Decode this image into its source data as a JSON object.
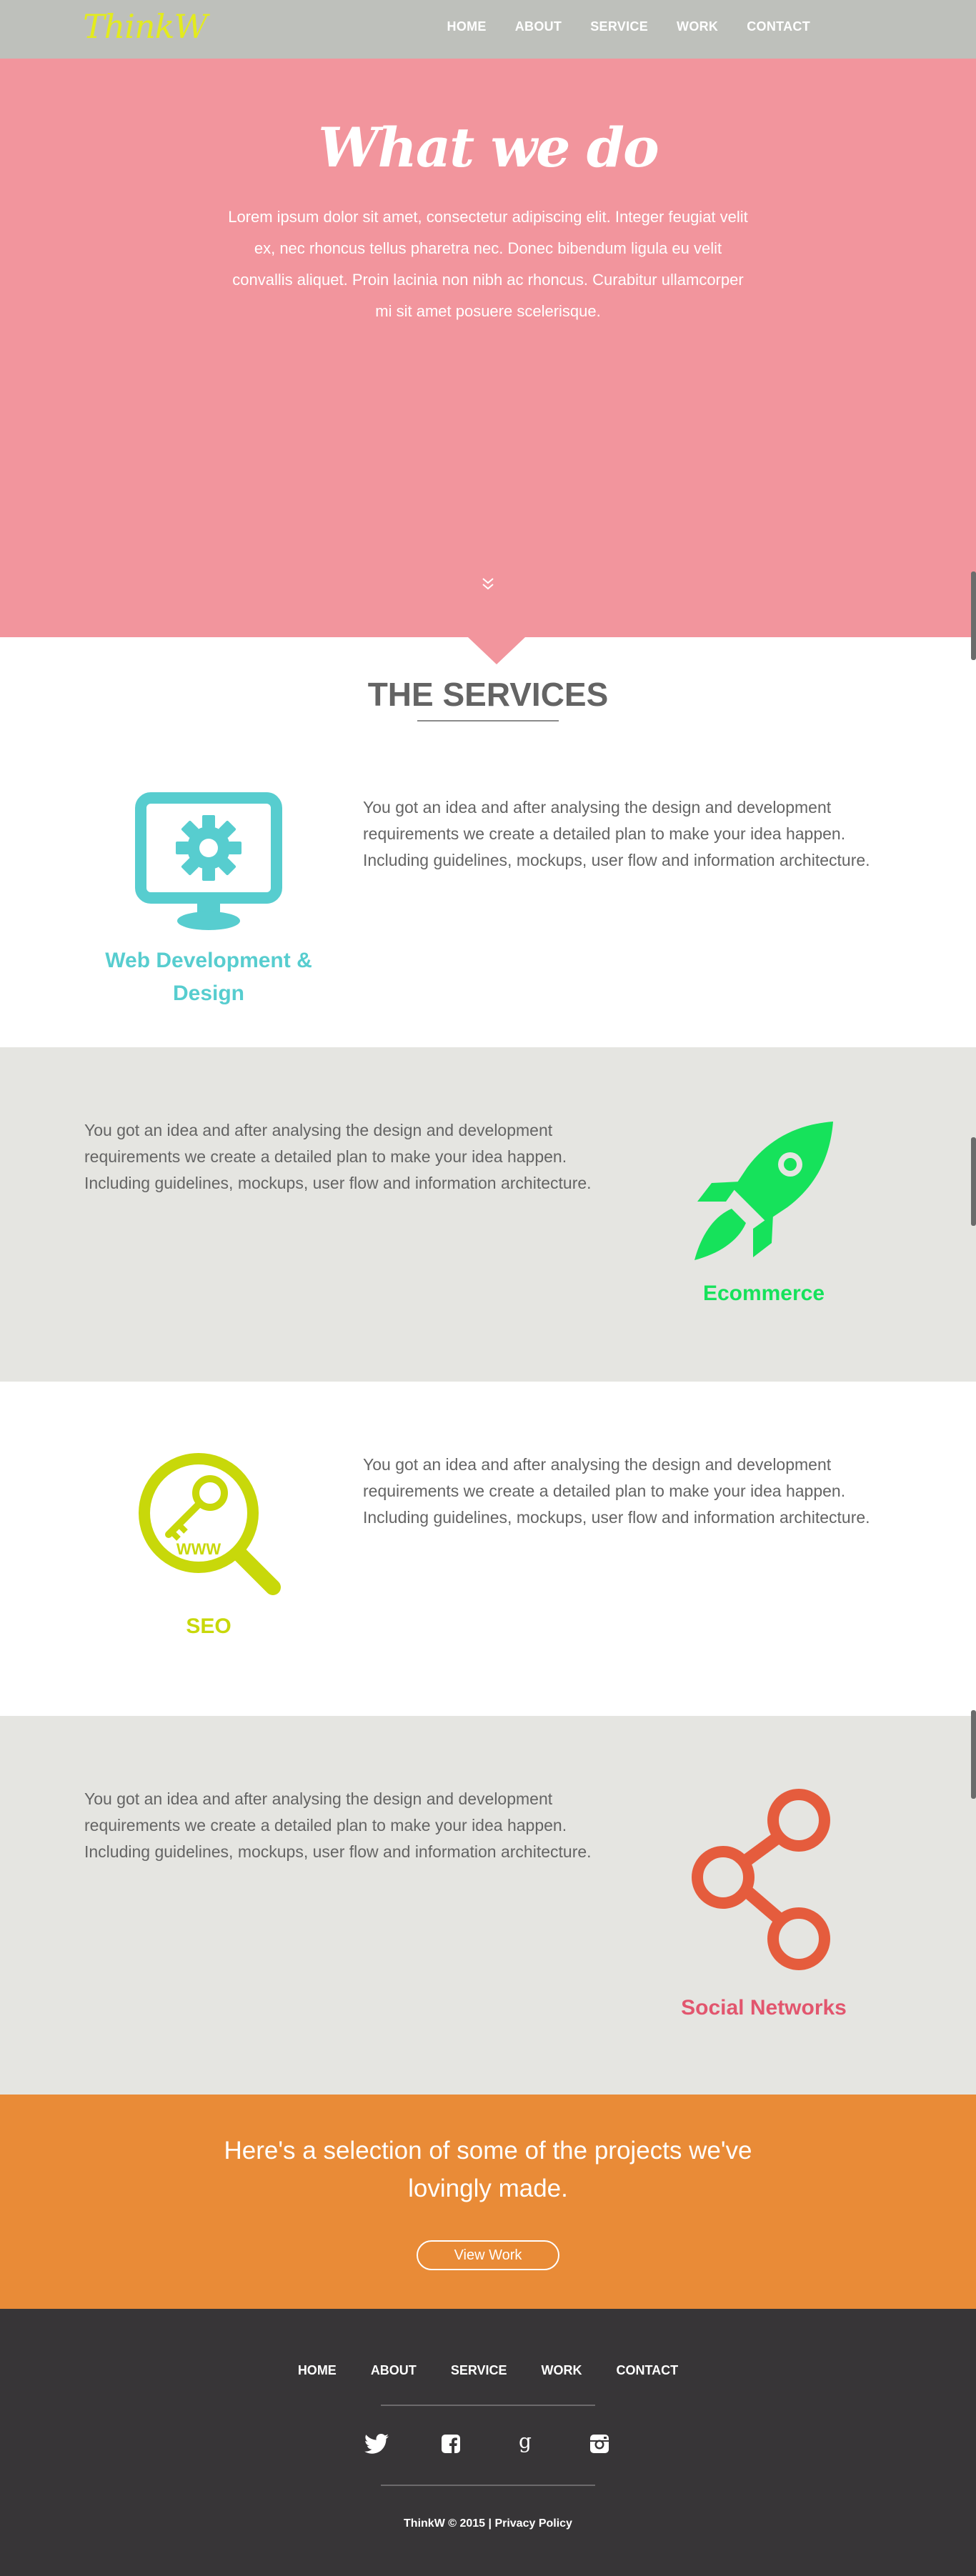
{
  "nav": {
    "logo": "ThinkW",
    "links": [
      "HOME",
      "ABOUT",
      "SERVICE",
      "WORK",
      "CONTACT"
    ]
  },
  "hero": {
    "title": "What we do",
    "text": "Lorem ipsum dolor sit amet, consectetur adipiscing elit. Integer feugiat velit ex, nec rhoncus tellus pharetra nec. Donec bibendum ligula eu velit convallis aliquet. Proin lacinia non nibh ac rhoncus. Curabitur ullamcorper mi sit amet posuere scelerisque.",
    "scroll_icon": "double-chevron-down-icon"
  },
  "services": {
    "title": "THE SERVICES",
    "items": [
      {
        "name": "Web Development & Design",
        "text": "You got an idea and after analysing the design and development requirements we create a detailed plan to make your idea happen. Including guidelines, mockups, user flow and information architecture.",
        "icon": "monitor-gear-icon",
        "color": "#57cdcf"
      },
      {
        "name": "Ecommerce",
        "text": "You got an idea and after analysing the design and development requirements we create a detailed plan to make your idea happen. Including guidelines, mockups, user flow and information architecture.",
        "icon": "rocket-icon",
        "color": "#16e25b"
      },
      {
        "name": "SEO",
        "text": "You got an idea and after analysing the design and development requirements we create a detailed plan to make your idea happen. Including guidelines, mockups, user flow and information architecture.",
        "icon": "magnifier-key-icon",
        "color": "#c8d80a"
      },
      {
        "name": "Social Networks",
        "text": "You got an idea and after analysing the design and development requirements we create a detailed plan to make your idea happen. Including guidelines, mockups, user flow and information architecture.",
        "icon": "share-icon",
        "color": "#e55c3d",
        "label_color": "#e2566e"
      }
    ]
  },
  "projects": {
    "title": "Here's a selection of some of the projects we've lovingly made.",
    "button": "View Work"
  },
  "footer": {
    "links": [
      "HOME",
      "ABOUT",
      "SERVICE",
      "WORK",
      "CONTACT"
    ],
    "socials": [
      "twitter-icon",
      "facebook-icon",
      "google-plus-icon",
      "instagram-icon"
    ],
    "copyright": "ThinkW © 2015 | ",
    "privacy": "Privacy Policy"
  },
  "colors": {
    "nav_bg": "#bec0bb",
    "hero_bg": "#f2959d",
    "grey_band": "#e5e5e1",
    "projects_bg": "#e98b37",
    "footer_bg": "#373537",
    "logo": "#e3eb1d"
  }
}
